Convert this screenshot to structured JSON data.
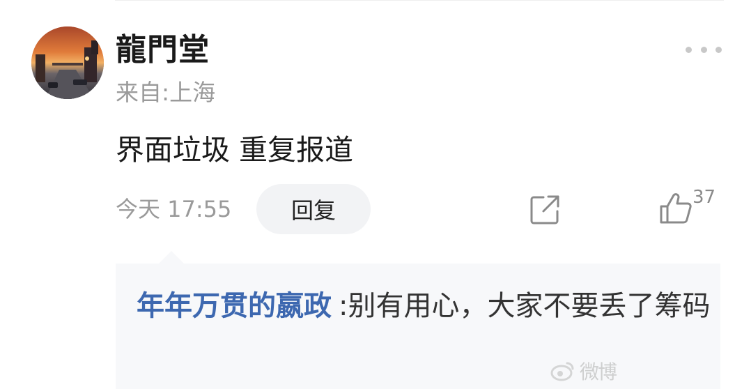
{
  "comment": {
    "username": "龍門堂",
    "location": "来自:上海",
    "text": "界面垃圾 重复报道",
    "timestamp": "今天 17:55",
    "reply_label": "回复",
    "like_count": "37",
    "icons": {
      "more": "more-dots-icon",
      "share": "share-icon",
      "like": "thumbs-up-icon"
    }
  },
  "reply": {
    "author": "年年万贯的嬴政",
    "separator": ":",
    "text": "别有用心，大家不要丢了筹码"
  },
  "watermark": {
    "text": "微博"
  },
  "colors": {
    "link_blue": "#3d68b0",
    "muted_gray": "#9a9a9a",
    "reply_bg": "#f7f8fa",
    "button_bg": "#f2f3f5"
  }
}
